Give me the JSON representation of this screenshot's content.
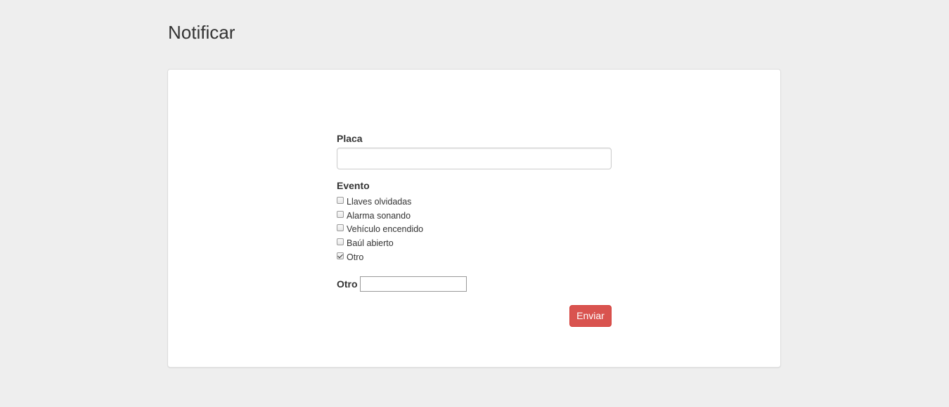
{
  "page": {
    "title": "Notificar"
  },
  "form": {
    "placa_label": "Placa",
    "placa_value": "",
    "evento_label": "Evento",
    "events": [
      {
        "label": "Llaves olvidadas",
        "checked": false
      },
      {
        "label": "Alarma sonando",
        "checked": false
      },
      {
        "label": "Vehículo encendido",
        "checked": false
      },
      {
        "label": "Baúl abierto",
        "checked": false
      },
      {
        "label": "Otro",
        "checked": true
      }
    ],
    "otro_label": "Otro",
    "otro_value": "",
    "submit_label": "Enviar"
  },
  "colors": {
    "background": "#eeeeee",
    "panel": "#ffffff",
    "danger_button": "#d9534f",
    "text": "#333333"
  }
}
